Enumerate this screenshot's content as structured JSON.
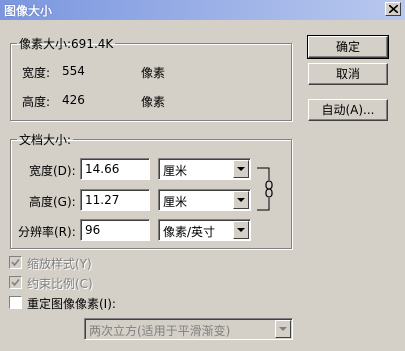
{
  "window": {
    "title": "图像大小"
  },
  "pixel_dimensions": {
    "legend": "像素大小:691.4K",
    "width_label": "宽度:",
    "width_value": "554",
    "width_unit": "像素",
    "height_label": "高度:",
    "height_value": "426",
    "height_unit": "像素"
  },
  "document_size": {
    "legend": "文档大小:",
    "width_label": "宽度(D):",
    "width_value": "14.66",
    "width_unit": "厘米",
    "height_label": "高度(G):",
    "height_value": "11.27",
    "height_unit": "厘米",
    "resolution_label": "分辨率(R):",
    "resolution_value": "96",
    "resolution_unit": "像素/英寸"
  },
  "buttons": {
    "ok": "确定",
    "cancel": "取消",
    "auto": "自动(A)..."
  },
  "options": {
    "scale_styles": {
      "label": "缩放样式(Y)",
      "checked": true,
      "enabled": false
    },
    "constrain": {
      "label": "约束比例(C)",
      "checked": true,
      "enabled": false
    },
    "resample": {
      "label": "重定图像像素(I):",
      "checked": false,
      "enabled": true
    },
    "resample_method": "两次立方(适用于平滑渐变)"
  }
}
